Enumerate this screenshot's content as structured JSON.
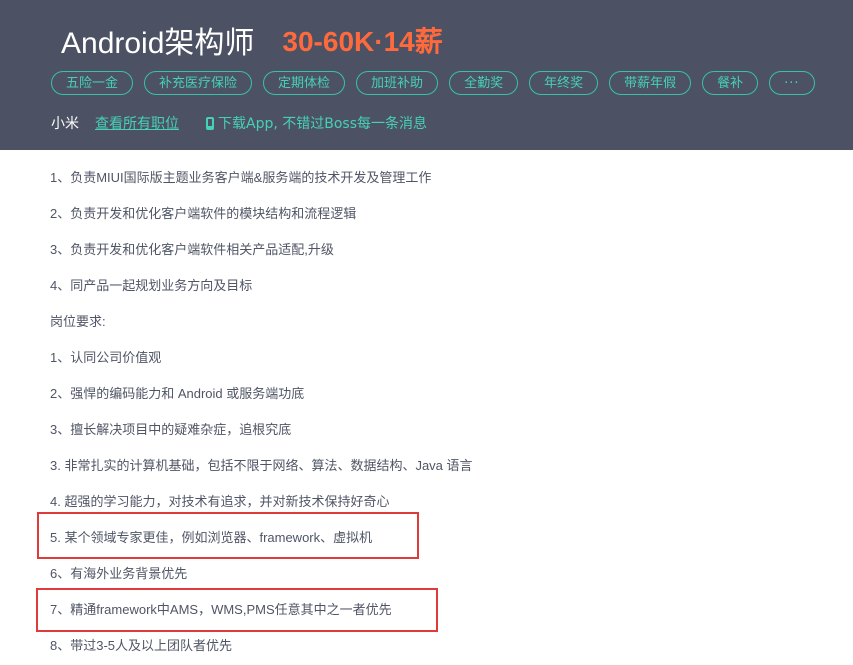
{
  "job": {
    "title": "Android架构师",
    "salary": "30-60K·14薪"
  },
  "tags": [
    "五险一金",
    "补充医疗保险",
    "定期体检",
    "加班补助",
    "全勤奖",
    "年终奖",
    "带薪年假",
    "餐补",
    "···"
  ],
  "company": {
    "name": "小米",
    "all_jobs_link": "查看所有职位",
    "download_text": "下载App, 不错过Boss每一条消息"
  },
  "description": [
    "1、负责MIUI国际版主题业务客户端&服务端的技术开发及管理工作",
    "2、负责开发和优化客户端软件的模块结构和流程逻辑",
    "3、负责开发和优化客户端软件相关产品适配,升级",
    "4、同产品一起规划业务方向及目标",
    "岗位要求:",
    "1、认同公司价值观",
    "2、强悍的编码能力和 Android 或服务端功底",
    "3、擅长解决项目中的疑难杂症，追根究底",
    "3. 非常扎实的计算机基础，包括不限于网络、算法、数据结构、Java 语言",
    "4. 超强的学习能力，对技术有追求，并对新技术保持好奇心",
    "5. 某个领域专家更佳，例如浏览器、framework、虚拟机",
    "6、有海外业务背景优先",
    "7、精通framework中AMS，WMS,PMS任意其中之一者优先",
    "8、带过3-5人及以上团队者优先"
  ],
  "colors": {
    "header_bg": "#4c5264",
    "accent": "#46d0b6",
    "salary": "#ff6a3d",
    "annotation": "#e03b3b"
  }
}
